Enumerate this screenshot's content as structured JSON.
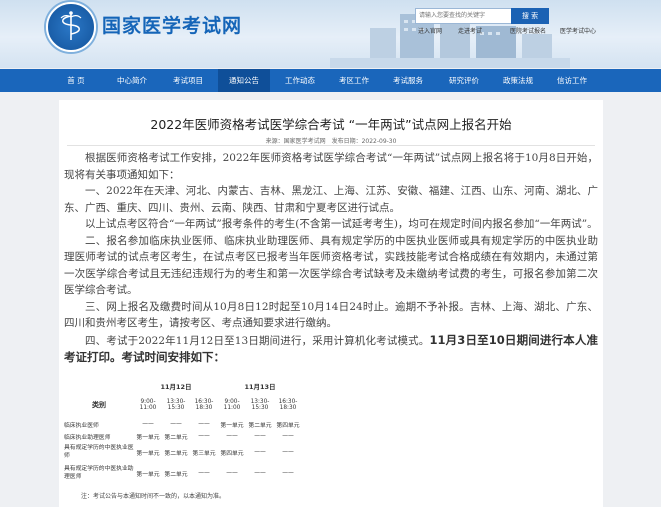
{
  "header": {
    "site_name": "国家医学考试网",
    "search_placeholder": "请输入您要查找的关键字",
    "search_button": "搜 索",
    "quick_links": [
      "进入官网",
      "走进考试",
      "医院考试报名",
      "医学考试中心"
    ]
  },
  "nav": {
    "items": [
      "首 页",
      "中心简介",
      "考试项目",
      "通知公告",
      "工作动态",
      "考区工作",
      "考试服务",
      "研究评价",
      "政策法规",
      "信访工作"
    ],
    "active_index": 3
  },
  "article": {
    "title": "2022年医师资格考试医学综合考试 “一年两试”试点网上报名开始",
    "source": "来源：国家医学考试网　发布日期：2022-09-30",
    "paragraphs": [
      "根据医师资格考试工作安排，2022年医师资格考试医学综合考试“一年两试”试点网上报名将于10月8日开始，现将有关事项通知如下：",
      "一、2022年在天津、河北、内蒙古、吉林、黑龙江、上海、江苏、安徽、福建、江西、山东、河南、湖北、广东、广西、重庆、四川、贵州、云南、陕西、甘肃和宁夏考区进行试点。",
      "以上试点考区符合“一年两试”报考条件的考生(不含第一试延考考生)，均可在规定时间内报名参加“一年两试”。",
      "二、报名参加临床执业医师、临床执业助理医师、具有规定学历的中医执业医师或具有规定学历的中医执业助理医师考试的试点考区考生，在试点考区已报考当年医师资格考试，实践技能考试合格成绩在有效期内，未通过第一次医学综合考试且无违纪违规行为的考生和第一次医学综合考试缺考及未缴纳考试费的考生，可报名参加第二次医学综合考试。",
      "三、网上报名及缴费时间从10月8日12时起至10月14日24时止。逾期不予补报。吉林、上海、湖北、广东、四川和贵州考区考生，请按考区、考点通知要求进行缴纳。"
    ],
    "exam_time_text": "四、考试于2022年11月12日至13日期间进行，采用计算机化考试模式。",
    "ticket_text": "11月3日至10日期间进行本人准考证打印。考试时间安排如下：",
    "note": "注：考试公告与本通知时间不一致的，以本通知为准。"
  },
  "schedule": {
    "category_header": "类别",
    "dates": [
      "11月12日",
      "11月13日"
    ],
    "slots": [
      "9:00-11:00",
      "13:30-15:30",
      "16:30-18:30",
      "9:00-11:00",
      "13:30-15:30",
      "16:30-18:30"
    ],
    "rows": [
      {
        "name": "临床执业医师",
        "cells": [
          "——",
          "——",
          "——",
          "第一单元",
          "第二单元",
          "第四单元"
        ]
      },
      {
        "name": "临床执业助理医师",
        "cells": [
          "第一单元",
          "第二单元",
          "——",
          "——",
          "——",
          "——"
        ]
      },
      {
        "name": "具有规定学历的中医执业医师",
        "cells": [
          "第一单元",
          "第二单元",
          "第三单元",
          "第四单元",
          "——",
          "——"
        ]
      },
      {
        "name": "具有规定学历的中医执业助理医师",
        "cells": [
          "第一单元",
          "第二单元",
          "——",
          "——",
          "——",
          "——"
        ]
      }
    ]
  },
  "colors": {
    "brand_blue": "#1a66bb",
    "nav_active": "#0f4f99",
    "background": "#eef0f3"
  }
}
